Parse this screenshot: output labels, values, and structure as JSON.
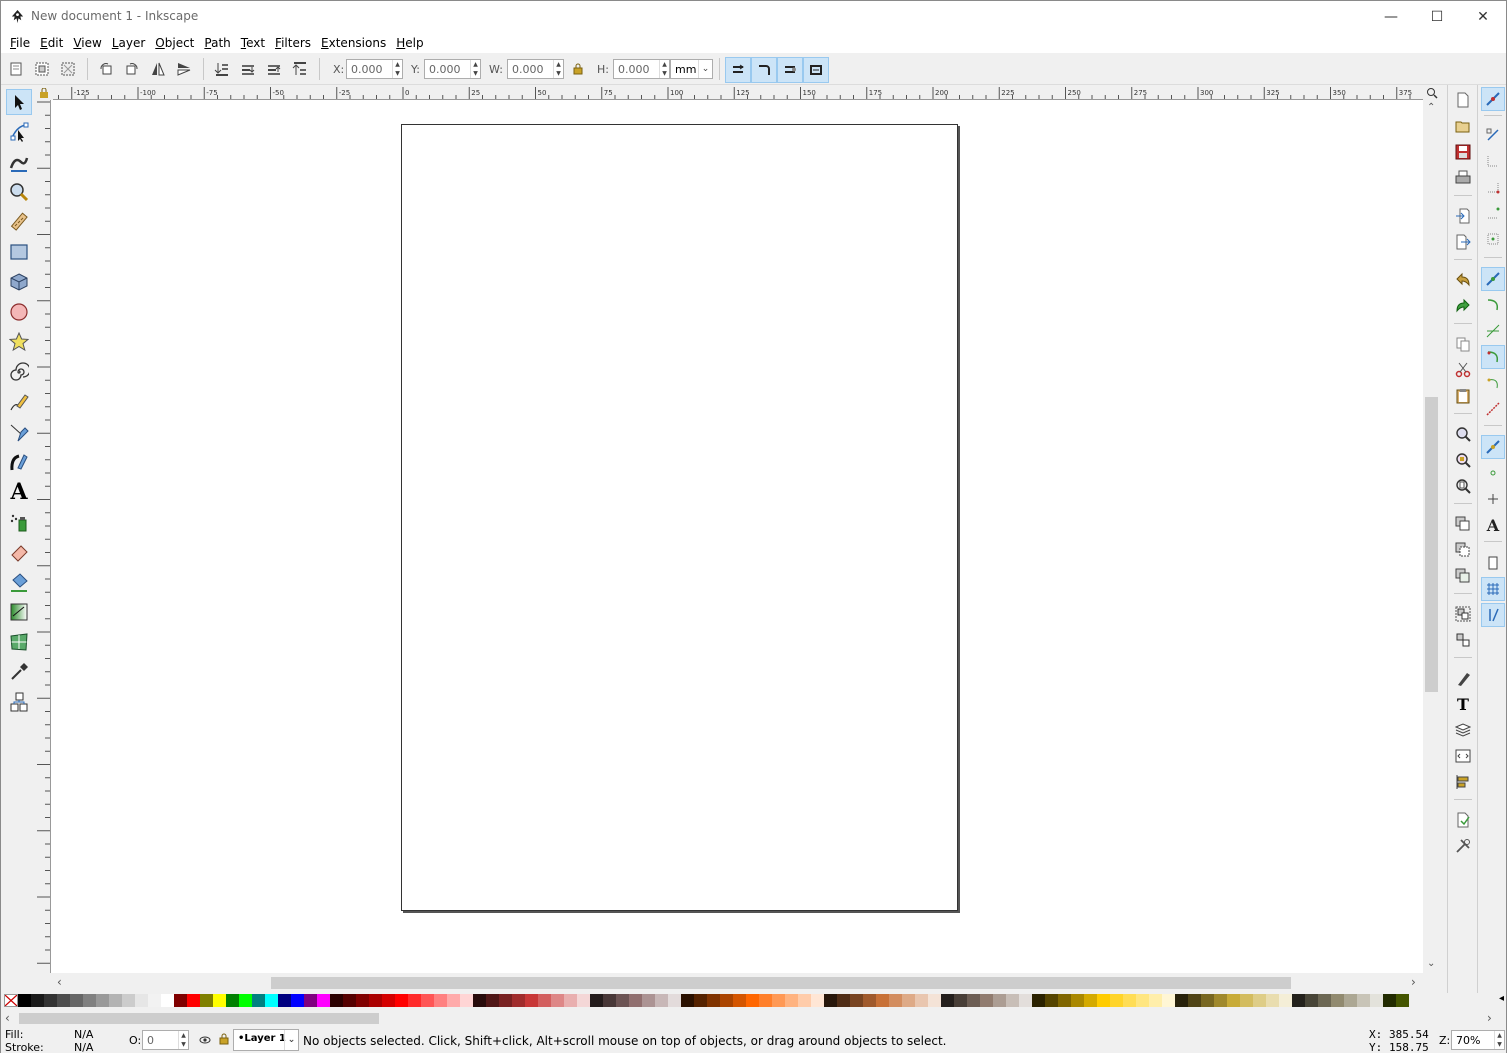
{
  "window": {
    "title": "New document 1 - Inkscape",
    "minimize": "—",
    "maximize": "☐",
    "close": "✕"
  },
  "menu": [
    {
      "label": "File",
      "u": "F",
      "rest": "ile"
    },
    {
      "label": "Edit",
      "u": "E",
      "rest": "dit"
    },
    {
      "label": "View",
      "u": "V",
      "rest": "iew"
    },
    {
      "label": "Layer",
      "u": "L",
      "rest": "ayer"
    },
    {
      "label": "Object",
      "u": "O",
      "rest": "bject"
    },
    {
      "label": "Path",
      "u": "P",
      "rest": "ath"
    },
    {
      "label": "Text",
      "u": "T",
      "rest": "ext"
    },
    {
      "label": "Filters",
      "u": "F",
      "rest": "ilters"
    },
    {
      "label": "Extensions",
      "u": "E",
      "rest": "xtensions"
    },
    {
      "label": "Help",
      "u": "H",
      "rest": "elp"
    }
  ],
  "toolbar": {
    "x_label": "X:",
    "x_value": "0.000",
    "y_label": "Y:",
    "y_value": "0.000",
    "w_label": "W:",
    "w_value": "0.000",
    "h_label": "H:",
    "h_value": "0.000",
    "unit": "mm"
  },
  "ruler": {
    "h_ticks": [
      "-125",
      "-100",
      "-75",
      "-50",
      "-25",
      "0",
      "25",
      "50",
      "75",
      "100",
      "125",
      "150",
      "175",
      "200",
      "225",
      "250",
      "275",
      "300",
      "325",
      "350",
      "375"
    ]
  },
  "status": {
    "fill_label": "Fill:",
    "fill_value": "N/A",
    "stroke_label": "Stroke:",
    "stroke_value": "N/A",
    "opacity_label": "O:",
    "opacity_value": "0",
    "layer": "•Layer 1",
    "message": "No objects selected. Click, Shift+click, Alt+scroll mouse on top of objects, or drag around objects to select.",
    "x_label": "X:",
    "x_value": "385.54",
    "y_label": "Y:",
    "y_value": "158.75",
    "zoom_label": "Z:",
    "zoom_value": "70%"
  },
  "palette": [
    "#000000",
    "#1a1a1a",
    "#333333",
    "#4d4d4d",
    "#666666",
    "#808080",
    "#999999",
    "#b3b3b3",
    "#cccccc",
    "#e6e6e6",
    "#f2f2f2",
    "#ffffff",
    "#800000",
    "#ff0000",
    "#808000",
    "#ffff00",
    "#008000",
    "#00ff00",
    "#008080",
    "#00ffff",
    "#000080",
    "#0000ff",
    "#800080",
    "#ff00ff",
    "#2b0000",
    "#550000",
    "#800000",
    "#aa0000",
    "#d40000",
    "#ff0000",
    "#ff2a2a",
    "#ff5555",
    "#ff8080",
    "#ffaaaa",
    "#ffd5d5",
    "#280b0b",
    "#501616",
    "#782121",
    "#a02c2c",
    "#c83737",
    "#d35f5f",
    "#de8787",
    "#e9afaf",
    "#f4d7d7",
    "#241c1c",
    "#483737",
    "#6c5353",
    "#916f6f",
    "#ac9393",
    "#c8b7b7",
    "#e3dbdb",
    "#2b1100",
    "#552200",
    "#803300",
    "#aa4400",
    "#d45500",
    "#ff6600",
    "#ff7f2a",
    "#ff9955",
    "#ffb380",
    "#ffccaa",
    "#ffe6d5",
    "#28170b",
    "#502d16",
    "#784421",
    "#a05a2c",
    "#c87137",
    "#d38d5f",
    "#deaa87",
    "#e9c6af",
    "#f4e3d7",
    "#241f1c",
    "#483e37",
    "#6c5d53",
    "#917c6f",
    "#ac9d93",
    "#c8beb7",
    "#e3dedb",
    "#2b2200",
    "#554400",
    "#806600",
    "#aa8800",
    "#d4aa00",
    "#ffcc00",
    "#ffd42a",
    "#ffdd55",
    "#ffe680",
    "#ffeeaa",
    "#fff6d5",
    "#28220b",
    "#504416",
    "#786721",
    "#a0892c",
    "#c8ab37",
    "#d3bc5f",
    "#decd87",
    "#e9ddaf",
    "#f4eed7",
    "#24221c",
    "#484537",
    "#6c6753",
    "#918a6f",
    "#aca793",
    "#c8c4b7",
    "#e3e2db",
    "#222b00",
    "#445500"
  ]
}
